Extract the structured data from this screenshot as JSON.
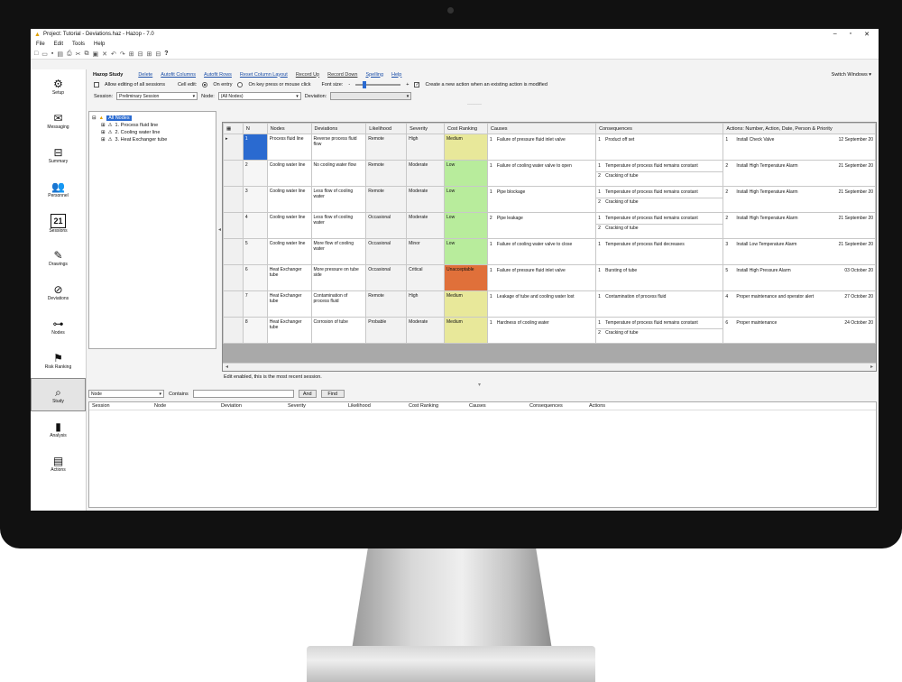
{
  "window": {
    "title": "Project: Tutorial - Deviations.haz - Hazop - 7.0"
  },
  "menu": [
    "File",
    "Edit",
    "Tools",
    "Help"
  ],
  "nav": [
    {
      "label": "Setup",
      "icon": "setup-icon"
    },
    {
      "label": "Messaging",
      "icon": "envelope-icon"
    },
    {
      "label": "Summary",
      "icon": "summary-icon"
    },
    {
      "label": "Personnel",
      "icon": "people-icon"
    },
    {
      "label": "Sessions",
      "icon": "calendar-icon",
      "badge": "21"
    },
    {
      "label": "Drawings",
      "icon": "pencil-icon"
    },
    {
      "label": "Deviations",
      "icon": "deviation-icon"
    },
    {
      "label": "Nodes",
      "icon": "nodes-icon"
    },
    {
      "label": "Risk Ranking",
      "icon": "flag-icon"
    },
    {
      "label": "Study",
      "icon": "study-icon"
    },
    {
      "label": "Analysis",
      "icon": "bar-chart-icon"
    },
    {
      "label": "Actions",
      "icon": "actions-icon"
    }
  ],
  "study": {
    "heading": "Hazop Study",
    "links": [
      "Delete",
      "Autofit Columns",
      "Autofit Rows",
      "Reset Column Layout",
      "Record Up",
      "Record Down",
      "Spelling",
      "Help"
    ],
    "switch_windows": "Switch Windows"
  },
  "options": {
    "allow_editing": "Allow editing of all sessions",
    "cell_edit": "Cell edit:",
    "on_entry": "On entry",
    "on_key": "On key press or mouse click",
    "font_size": "Font size:",
    "minus": "-",
    "plus": "+",
    "create_action": "Create a new action when an existing action is modified",
    "create_action_check": "✓"
  },
  "filters": {
    "session_label": "Session:",
    "session_value": "Preliminary Session",
    "node_label": "Node:",
    "node_value": "(All Nodes)",
    "deviation_label": "Deviation:",
    "deviation_value": ""
  },
  "tree": {
    "root": "All Nodes",
    "items": [
      "1. Process fluid line",
      "2. Cooling water line",
      "3. Heat Exchanger tube"
    ]
  },
  "grid": {
    "headers": [
      "N",
      "Nodes",
      "Deviations",
      "Likelihood",
      "Severity",
      "Cost Ranking",
      "Causes",
      "Consequences",
      "Actions: Number, Action, Date, Person & Priority"
    ],
    "rows": [
      {
        "n": "1",
        "node": "Process fluid line",
        "deviation": "Reverse process fluid flow",
        "likelihood": "Remote",
        "severity": "High",
        "cost": "Medium",
        "cost_color": "#e8e89a",
        "causes": [
          [
            "1",
            "Failure of pressure fluid inlet valve"
          ]
        ],
        "consequences": [
          [
            "1",
            "Product off set"
          ]
        ],
        "actions": [
          [
            "1",
            "Install Check Valve",
            "12 September 20"
          ]
        ]
      },
      {
        "n": "2",
        "node": "Cooling water line",
        "deviation": "No cooling water flow",
        "likelihood": "Remote",
        "severity": "Moderate",
        "cost": "Low",
        "cost_color": "#b8ec9c",
        "causes": [
          [
            "1",
            "Failure of cooling water valve to open"
          ]
        ],
        "consequences": [
          [
            "1",
            "Temperature of process fluid remains constant"
          ],
          [
            "2",
            "Cracking of tube"
          ]
        ],
        "actions": [
          [
            "2",
            "Install High Temperature Alarm",
            "21 September 20"
          ]
        ]
      },
      {
        "n": "3",
        "node": "Cooling water line",
        "deviation": "Less flow of cooling water",
        "likelihood": "Remote",
        "severity": "Moderate",
        "cost": "Low",
        "cost_color": "#b8ec9c",
        "causes": [
          [
            "1",
            "Pipe blockage"
          ]
        ],
        "consequences": [
          [
            "1",
            "Temperature of process fluid remains constant"
          ],
          [
            "2",
            "Cracking of tube"
          ]
        ],
        "actions": [
          [
            "2",
            "Install High Temperature Alarm",
            "21 September 20"
          ]
        ]
      },
      {
        "n": "4",
        "node": "Cooling water line",
        "deviation": "Less flow of cooling water",
        "likelihood": "Occasional",
        "severity": "Moderate",
        "cost": "Low",
        "cost_color": "#b8ec9c",
        "causes": [
          [
            "2",
            "Pipe leakage"
          ]
        ],
        "consequences": [
          [
            "1",
            "Temperature of process fluid remains constant"
          ],
          [
            "2",
            "Cracking of tube"
          ]
        ],
        "actions": [
          [
            "2",
            "Install High Temperature Alarm",
            "21 September 20"
          ]
        ]
      },
      {
        "n": "5",
        "node": "Cooling water line",
        "deviation": "More flow of cooling water",
        "likelihood": "Occasional",
        "severity": "Minor",
        "cost": "Low",
        "cost_color": "#b8ec9c",
        "causes": [
          [
            "1",
            "Failure of cooling water valve to close"
          ]
        ],
        "consequences": [
          [
            "1",
            "Temperature of process fluid decreases"
          ]
        ],
        "actions": [
          [
            "3",
            "Install Low Temperature Alarm",
            "21 September 20"
          ]
        ]
      },
      {
        "n": "6",
        "node": "Heat Exchanger tube",
        "deviation": "More pressure on tube side",
        "likelihood": "Occasional",
        "severity": "Critical",
        "cost": "Unacceptable",
        "cost_color": "#e0703a",
        "causes": [
          [
            "1",
            "Failure of pressure fluid inlet valve"
          ]
        ],
        "consequences": [
          [
            "1",
            "Bursting of tube"
          ]
        ],
        "actions": [
          [
            "5",
            "Install High Pressure Alarm",
            "03 October 20"
          ]
        ]
      },
      {
        "n": "7",
        "node": "Heat Exchanger tube",
        "deviation": "Contamination of process fluid",
        "likelihood": "Remote",
        "severity": "High",
        "cost": "Medium",
        "cost_color": "#e8e89a",
        "causes": [
          [
            "1",
            "Leakage of tube and cooling water lost"
          ]
        ],
        "consequences": [
          [
            "1",
            "Contamination of process fluid"
          ]
        ],
        "actions": [
          [
            "4",
            "Proper maintenance and operator alert",
            "27 October 20"
          ]
        ]
      },
      {
        "n": "8",
        "node": "Heat Exchanger tube",
        "deviation": "Corrosion of tube",
        "likelihood": "Probable",
        "severity": "Moderate",
        "cost": "Medium",
        "cost_color": "#e8e89a",
        "causes": [
          [
            "1",
            "Hardness of cooling water"
          ]
        ],
        "consequences": [
          [
            "1",
            "Temperature of process fluid remains constant"
          ],
          [
            "2",
            "Cracking of tube"
          ]
        ],
        "actions": [
          [
            "6",
            "Proper maintenance",
            "24 October 20"
          ]
        ]
      }
    ]
  },
  "status_message": "Edit enabled, this is the most recent session.",
  "search": {
    "field_value": "Node",
    "contains_label": "Contains",
    "and_label": "And",
    "find_label": "Find"
  },
  "results": {
    "headers": [
      "Session",
      "Node",
      "Deviation",
      "Severity",
      "Likelihood",
      "Cost Ranking",
      "Causes",
      "Consequences",
      "Actions"
    ]
  }
}
